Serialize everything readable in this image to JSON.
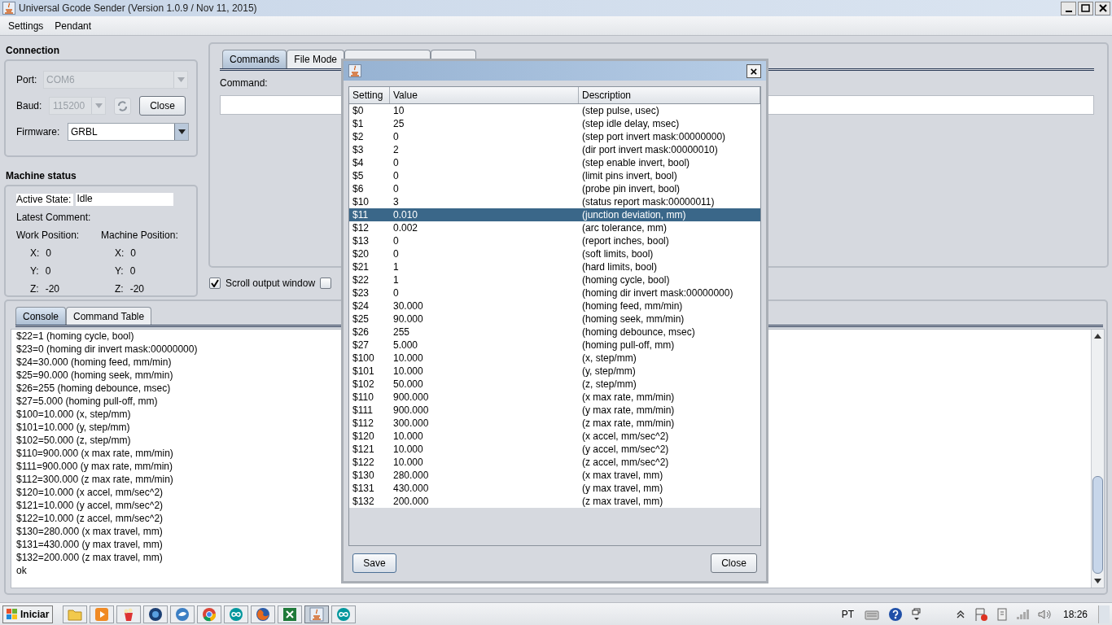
{
  "window": {
    "title": "Universal Gcode Sender (Version 1.0.9 / Nov 11, 2015)"
  },
  "menu": [
    "Settings",
    "Pendant"
  ],
  "connection": {
    "title": "Connection",
    "port": {
      "label": "Port:",
      "value": "COM6",
      "disabled": true
    },
    "baud": {
      "label": "Baud:",
      "value": "115200",
      "disabled": true
    },
    "close_button": "Close",
    "firmware": {
      "label": "Firmware:",
      "value": "GRBL",
      "disabled": false
    }
  },
  "machine_status": {
    "title": "Machine status",
    "active_state_label": "Active State:",
    "active_state": "Idle",
    "latest_comment_label": "Latest Comment:",
    "work_position_label": "Work Position:",
    "machine_position_label": "Machine Position:",
    "work": [
      {
        "axis": "X:",
        "value": "0"
      },
      {
        "axis": "Y:",
        "value": "0"
      },
      {
        "axis": "Z:",
        "value": "-20"
      }
    ],
    "machine": [
      {
        "axis": "X:",
        "value": "0"
      },
      {
        "axis": "Y:",
        "value": "0"
      },
      {
        "axis": "Z:",
        "value": "-20"
      }
    ]
  },
  "command_tabs": [
    {
      "label": "Commands",
      "selected": true
    },
    {
      "label": "File Mode",
      "selected": false
    }
  ],
  "command_label": "Command:",
  "checkboxes": [
    {
      "label": "Scroll output window",
      "checked": true
    },
    {
      "checked": false
    }
  ],
  "console_tabs": [
    {
      "label": "Console",
      "selected": true
    },
    {
      "label": "Command Table",
      "selected": false
    }
  ],
  "console_lines": [
    "$22=1 (homing cycle, bool)",
    "$23=0 (homing dir invert mask:00000000)",
    "$24=30.000 (homing feed, mm/min)",
    "$25=90.000 (homing seek, mm/min)",
    "$26=255 (homing debounce, msec)",
    "$27=5.000 (homing pull-off, mm)",
    "$100=10.000 (x, step/mm)",
    "$101=10.000 (y, step/mm)",
    "$102=50.000 (z, step/mm)",
    "$110=900.000 (x max rate, mm/min)",
    "$111=900.000 (y max rate, mm/min)",
    "$112=300.000 (z max rate, mm/min)",
    "$120=10.000 (x accel, mm/sec^2)",
    "$121=10.000 (y accel, mm/sec^2)",
    "$122=10.000 (z accel, mm/sec^2)",
    "$130=280.000 (x max travel, mm)",
    "$131=430.000 (y max travel, mm)",
    "$132=200.000 (z max travel, mm)",
    "ok"
  ],
  "dialog": {
    "close": "×",
    "columns": [
      "Setting",
      "Value",
      "Description"
    ],
    "rows": [
      {
        "setting": "$0",
        "value": "10",
        "description": "(step pulse, usec)",
        "selected": false
      },
      {
        "setting": "$1",
        "value": "25",
        "description": "(step idle delay, msec)",
        "selected": false
      },
      {
        "setting": "$2",
        "value": "0",
        "description": "(step port invert mask:00000000)",
        "selected": false
      },
      {
        "setting": "$3",
        "value": "2",
        "description": "(dir port invert mask:00000010)",
        "selected": false
      },
      {
        "setting": "$4",
        "value": "0",
        "description": "(step enable invert, bool)",
        "selected": false
      },
      {
        "setting": "$5",
        "value": "0",
        "description": "(limit pins invert, bool)",
        "selected": false
      },
      {
        "setting": "$6",
        "value": "0",
        "description": "(probe pin invert, bool)",
        "selected": false
      },
      {
        "setting": "$10",
        "value": "3",
        "description": "(status report mask:00000011)",
        "selected": false
      },
      {
        "setting": "$11",
        "value": "0.010",
        "description": "(junction deviation, mm)",
        "selected": true
      },
      {
        "setting": "$12",
        "value": "0.002",
        "description": "(arc tolerance, mm)",
        "selected": false
      },
      {
        "setting": "$13",
        "value": "0",
        "description": "(report inches, bool)",
        "selected": false
      },
      {
        "setting": "$20",
        "value": "0",
        "description": "(soft limits, bool)",
        "selected": false
      },
      {
        "setting": "$21",
        "value": "1",
        "description": "(hard limits, bool)",
        "selected": false
      },
      {
        "setting": "$22",
        "value": "1",
        "description": "(homing cycle, bool)",
        "selected": false
      },
      {
        "setting": "$23",
        "value": "0",
        "description": "(homing dir invert mask:00000000)",
        "selected": false
      },
      {
        "setting": "$24",
        "value": "30.000",
        "description": "(homing feed, mm/min)",
        "selected": false
      },
      {
        "setting": "$25",
        "value": "90.000",
        "description": "(homing seek, mm/min)",
        "selected": false
      },
      {
        "setting": "$26",
        "value": "255",
        "description": "(homing debounce, msec)",
        "selected": false
      },
      {
        "setting": "$27",
        "value": "5.000",
        "description": "(homing pull-off, mm)",
        "selected": false
      },
      {
        "setting": "$100",
        "value": "10.000",
        "description": "(x, step/mm)",
        "selected": false
      },
      {
        "setting": "$101",
        "value": "10.000",
        "description": "(y, step/mm)",
        "selected": false
      },
      {
        "setting": "$102",
        "value": "50.000",
        "description": "(z, step/mm)",
        "selected": false
      },
      {
        "setting": "$110",
        "value": "900.000",
        "description": "(x max rate, mm/min)",
        "selected": false
      },
      {
        "setting": "$111",
        "value": "900.000",
        "description": "(y max rate, mm/min)",
        "selected": false
      },
      {
        "setting": "$112",
        "value": "300.000",
        "description": "(z max rate, mm/min)",
        "selected": false
      },
      {
        "setting": "$120",
        "value": "10.000",
        "description": "(x accel, mm/sec^2)",
        "selected": false
      },
      {
        "setting": "$121",
        "value": "10.000",
        "description": "(y accel, mm/sec^2)",
        "selected": false
      },
      {
        "setting": "$122",
        "value": "10.000",
        "description": "(z accel, mm/sec^2)",
        "selected": false
      },
      {
        "setting": "$130",
        "value": "280.000",
        "description": "(x max travel, mm)",
        "selected": false
      },
      {
        "setting": "$131",
        "value": "430.000",
        "description": "(y max travel, mm)",
        "selected": false
      },
      {
        "setting": "$132",
        "value": "200.000",
        "description": "(z max travel, mm)",
        "selected": false
      }
    ],
    "save": "Save",
    "close_button": "Close"
  },
  "taskbar": {
    "start": "Iniciar",
    "items": [
      {
        "kind": "folder",
        "selected": false
      },
      {
        "kind": "media",
        "selected": false
      },
      {
        "kind": "gift",
        "selected": false
      },
      {
        "kind": "globe",
        "selected": false
      },
      {
        "kind": "bird",
        "selected": false
      },
      {
        "kind": "chrome",
        "selected": false
      },
      {
        "kind": "arduino",
        "selected": false
      },
      {
        "kind": "firefox",
        "selected": false
      },
      {
        "kind": "excel",
        "selected": false
      },
      {
        "kind": "java",
        "selected": true
      },
      {
        "kind": "arduino",
        "selected": false
      }
    ],
    "language": "PT",
    "time": "18:26"
  }
}
